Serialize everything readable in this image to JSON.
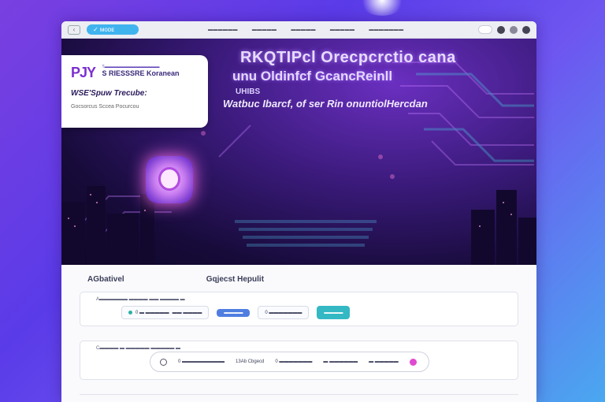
{
  "browser": {
    "address": "✓ ᴍᴏᴅᴇ",
    "back_label": "‹",
    "tabs": [
      "▬▬▬▬▬▬",
      "▬▬▬▬▬",
      "▬▬▬▬▬",
      "▬▬▬▬▬",
      "▬▬▬▬▬▬▬"
    ],
    "controls": [
      "",
      "●",
      "●",
      "●"
    ]
  },
  "hero": {
    "title": "RKQTIPcl Orecpcrctio cana",
    "subtitle": "unu Oldinfcf GcancReinll",
    "small_label": "UHIBS",
    "tagline": "Watbuc Ibarcf, of ser Rin onuntiolHercdan",
    "caption": "▬ ▬▬ ▬▬▬▬▬▬▬▬ ▬▬ ▬▬ ▬▬▬▬"
  },
  "card": {
    "logo": "PJY",
    "tag_small": "T▬▬▬▬▬▬▬▬▬▬▬▬▬▬",
    "tag_big": "S RIESSSRE Koranean",
    "line": "WSE'Spuw Trecube:",
    "sub": "Gocsorcus Sccea Pocurcou"
  },
  "content": {
    "label_left": "AGbativel",
    "label_right": "Gqjecst Hepulit",
    "panel1": {
      "title": "A▬▬▬▬▬▬ ▬▬▬▬ ▬▬ ▬▬▬▬ ▬",
      "chips": [
        "0 ▬ ▬▬▬▬▬",
        "▬▬ ▬▬▬▬",
        "▬▬▬▬",
        "0 ▬▬▬▬▬▬▬",
        "▬▬▬▬"
      ]
    },
    "panel2": {
      "title": "C▬▬▬▬ ▬ ▬▬▬▬▬ ▬▬▬▬▬ ▬",
      "items": [
        "0 ▬▬▬▬▬▬▬▬▬",
        "13Ab Cbgecd",
        "0 ▬▬▬▬▬▬▬",
        "▬ ▬▬▬▬▬▬",
        "▬ ▬▬▬▬▬"
      ]
    }
  },
  "colors": {
    "accent": "#3fb3ee",
    "brand": "#7a2fd0",
    "bg_gradient_start": "#7a3fe0",
    "bg_gradient_end": "#4aa8f0"
  }
}
